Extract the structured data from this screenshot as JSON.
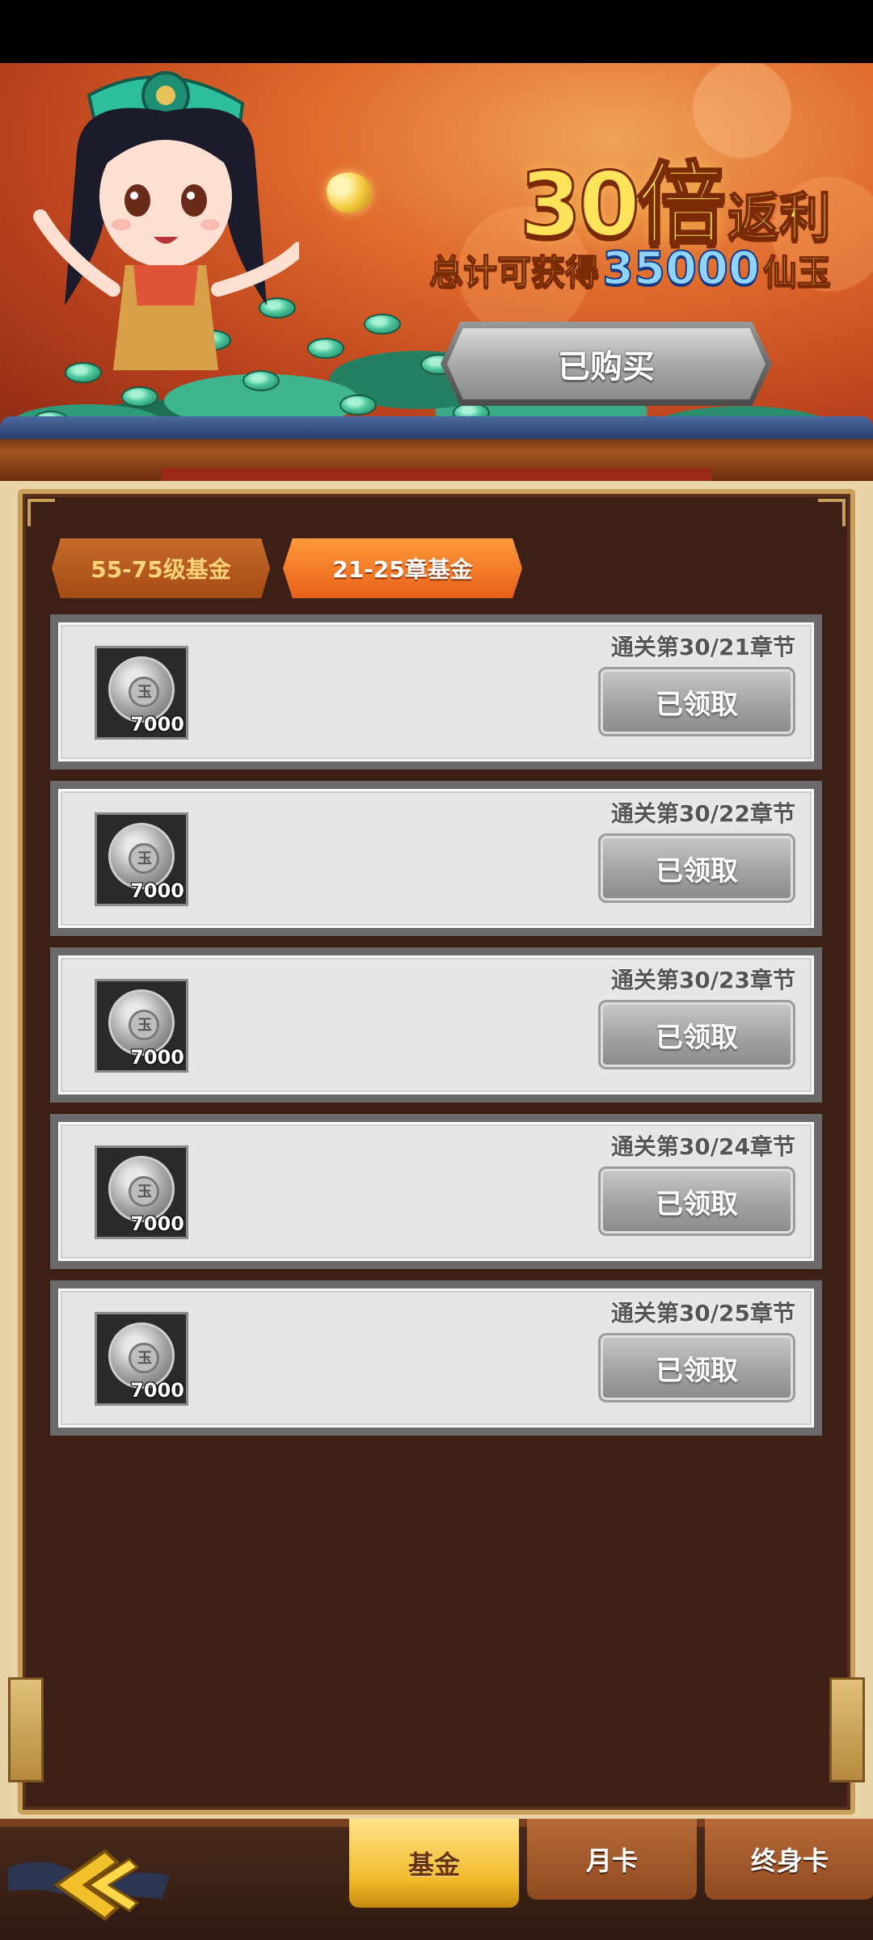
{
  "banner": {
    "headline_number": "30倍",
    "headline_text": "返利",
    "subline_prefix": "总计可获得",
    "subline_amount": "35000",
    "subline_suffix": "仙玉",
    "purchased_label": "已购买"
  },
  "fund_tabs": [
    {
      "label": "55-75级基金",
      "active": false
    },
    {
      "label": "21-25章基金",
      "active": true
    }
  ],
  "rewards": [
    {
      "requirement": "通关第30/21章节",
      "item_glyph": "玉",
      "count": "7000",
      "status": "已领取"
    },
    {
      "requirement": "通关第30/22章节",
      "item_glyph": "玉",
      "count": "7000",
      "status": "已领取"
    },
    {
      "requirement": "通关第30/23章节",
      "item_glyph": "玉",
      "count": "7000",
      "status": "已领取"
    },
    {
      "requirement": "通关第30/24章节",
      "item_glyph": "玉",
      "count": "7000",
      "status": "已领取"
    },
    {
      "requirement": "通关第30/25章节",
      "item_glyph": "玉",
      "count": "7000",
      "status": "已领取"
    }
  ],
  "bottom_nav": {
    "tabs": [
      {
        "label": "基金",
        "active": true
      },
      {
        "label": "月卡",
        "active": false
      },
      {
        "label": "终身卡",
        "active": false
      }
    ]
  },
  "colors": {
    "headline": "#ffe35a",
    "amount": "#8fd4ff",
    "panel": "#3d2015",
    "active_tab": "#ff9a3a"
  },
  "icons": [
    "jade-coin-icon",
    "back-arrow-icon"
  ]
}
